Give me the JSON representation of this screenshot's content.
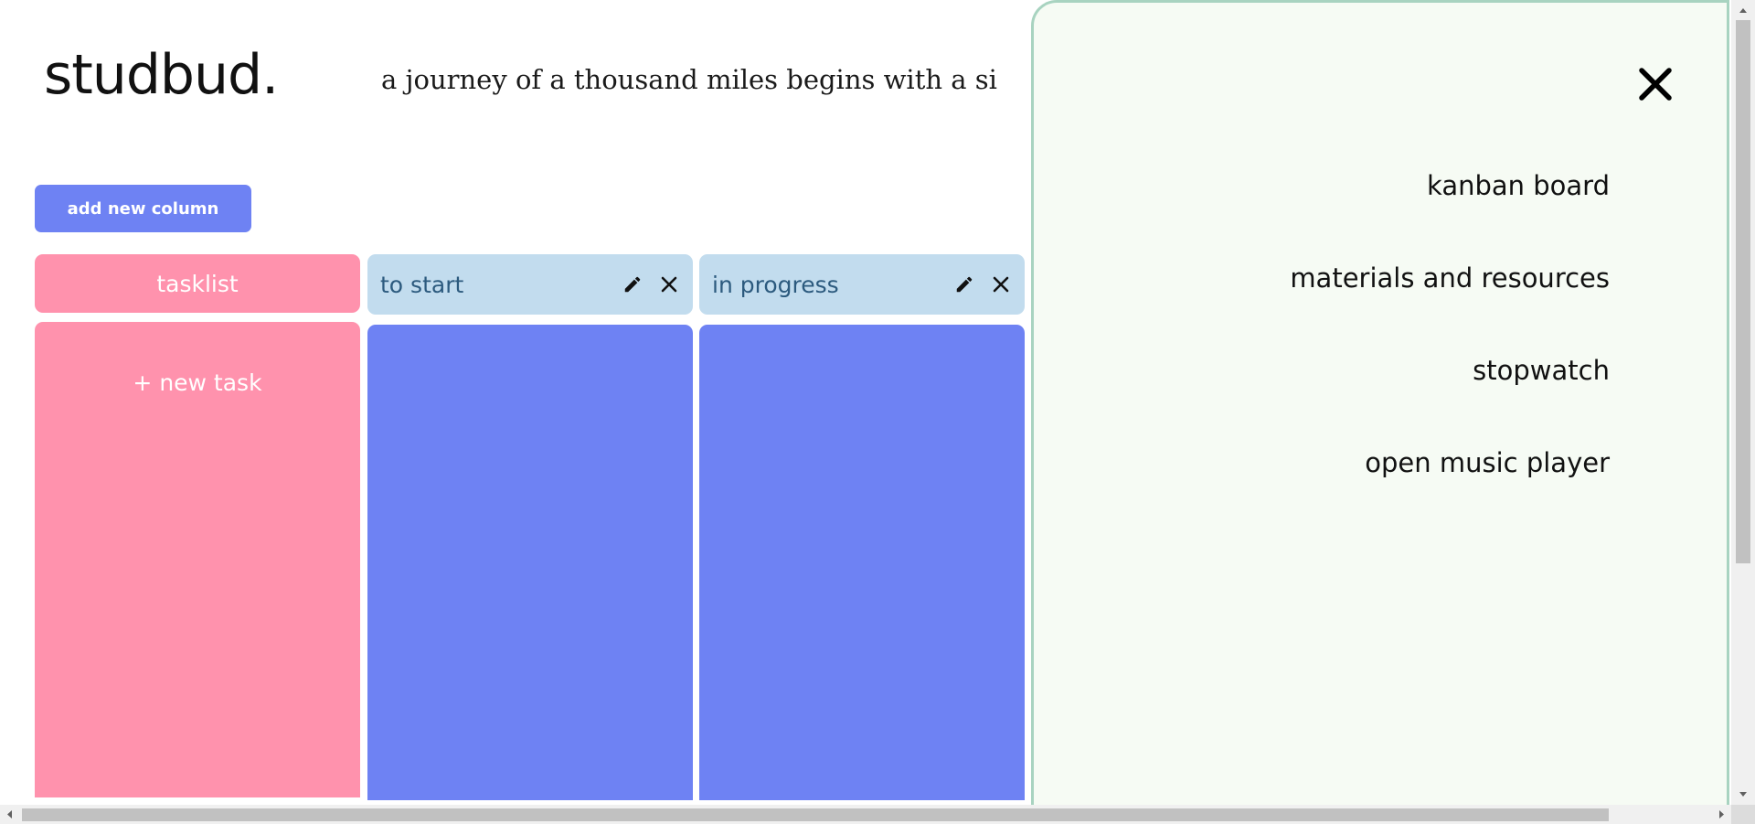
{
  "header": {
    "logo": "studbud.",
    "quote": "a journey of a thousand miles begins with a si"
  },
  "toolbar": {
    "add_column_label": "add new column"
  },
  "columns": [
    {
      "title": "tasklist",
      "action": "+ new task"
    },
    {
      "title": "to start",
      "icons": [
        "edit-icon",
        "close-icon"
      ]
    },
    {
      "title": "in progress",
      "icons": [
        "edit-icon",
        "close-icon"
      ]
    }
  ],
  "menu": {
    "close_icon": "close-icon",
    "items": [
      {
        "label": "kanban board"
      },
      {
        "label": "materials and resources"
      },
      {
        "label": "stopwatch"
      },
      {
        "label": "open music player"
      }
    ]
  },
  "colors": {
    "tasklist": "#ff92ad",
    "column_header": "#c2dcee",
    "column_body": "#6e82f3",
    "panel_bg": "#f6fbf4",
    "panel_border": "#a8d3c0"
  }
}
